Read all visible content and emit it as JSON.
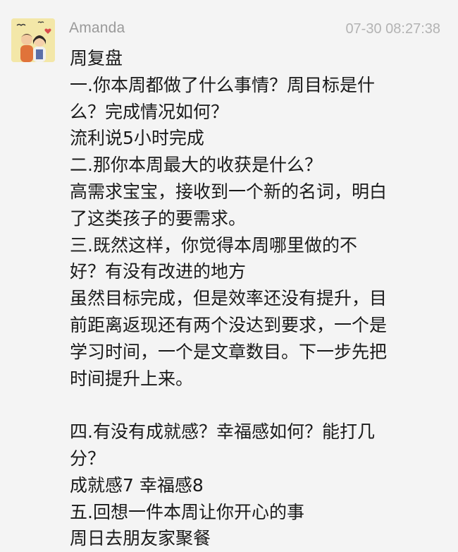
{
  "post": {
    "author": "Amanda",
    "timestamp": "07-30 08:27:38",
    "avatar_icon": "cartoon-couple-avatar-icon",
    "lines": [
      "周复盘",
      "一.你本周都做了什么事情？周目标是什",
      "么？完成情况如何？",
      "流利说5小时完成",
      "二.那你本周最大的收获是什么？",
      "高需求宝宝，接收到一个新的名词，明白",
      "了这类孩子的要需求。",
      "三.既然这样，你觉得本周哪里做的不",
      "好？有没有改进的地方",
      "虽然目标完成，但是效率还没有提升，目",
      "前距离返现还有两个没达到要求，一个是",
      "学习时间，一个是文章数目。下一步先把",
      "时间提升上来。",
      "",
      "四.有没有成就感？幸福感如何？能打几",
      "分？",
      "成就感7 幸福感8",
      "五.回想一件本周让你开心的事",
      "周日去朋友家聚餐"
    ]
  },
  "colors": {
    "background": "#f4f4f4",
    "author": "#9a9a9a",
    "timestamp": "#b3b3b3",
    "text": "#1a1a1a"
  }
}
